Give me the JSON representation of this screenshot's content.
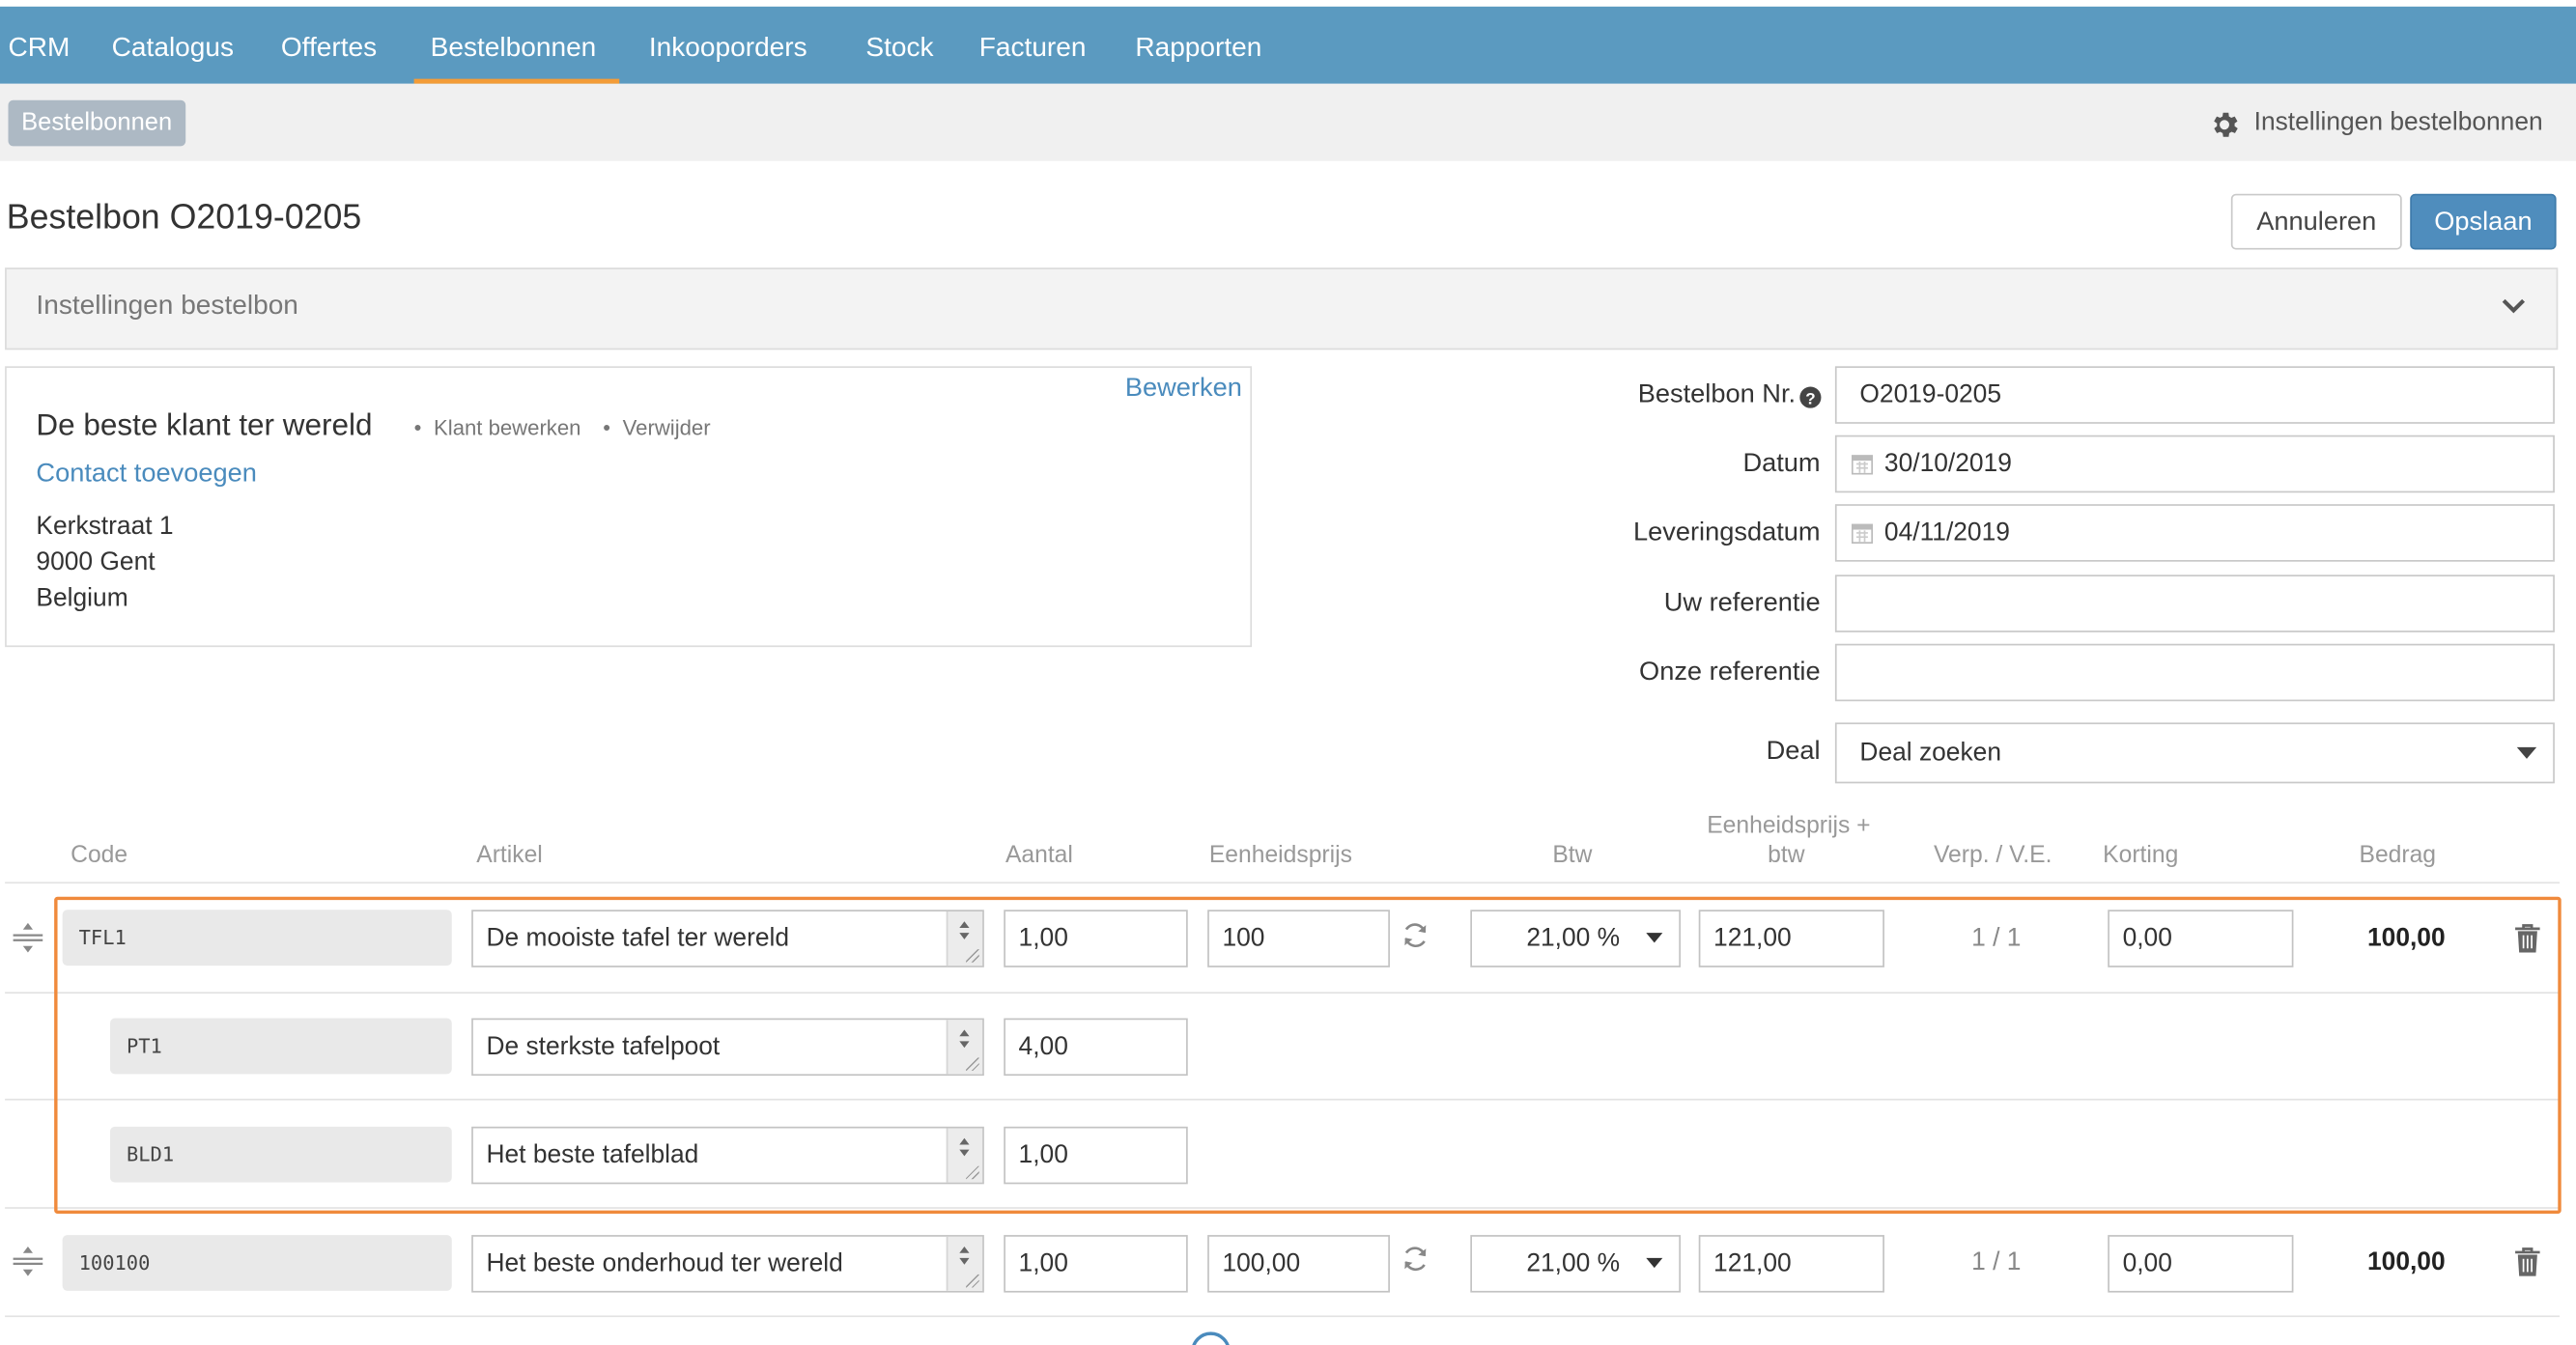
{
  "nav": {
    "items": [
      "CRM",
      "Catalogus",
      "Offertes",
      "Bestelbonnen",
      "Inkooporders",
      "Stock",
      "Facturen",
      "Rapporten"
    ],
    "active": "Bestelbonnen"
  },
  "subbar": {
    "breadcrumb": "Bestelbonnen",
    "settings_link": "Instellingen bestelbonnen"
  },
  "page": {
    "title": "Bestelbon O2019-0205",
    "cancel": "Annuleren",
    "save": "Opslaan"
  },
  "settings_panel": {
    "title": "Instellingen bestelbon"
  },
  "client": {
    "edit": "Bewerken",
    "name": "De beste klant ter wereld",
    "edit_client": "Klant bewerken",
    "remove": "Verwijder",
    "add_contact": "Contact toevoegen",
    "address_line1": "Kerkstraat 1",
    "address_line2": "9000 Gent",
    "country": "Belgium"
  },
  "form": {
    "order_no_label": "Bestelbon Nr.",
    "order_no": "O2019-0205",
    "date_label": "Datum",
    "date": "30/10/2019",
    "delivery_label": "Leveringsdatum",
    "delivery": "04/11/2019",
    "your_ref_label": "Uw referentie",
    "your_ref": "",
    "our_ref_label": "Onze referentie",
    "our_ref": "",
    "deal_label": "Deal",
    "deal_placeholder": "Deal zoeken"
  },
  "table": {
    "headers": {
      "code": "Code",
      "article": "Artikel",
      "qty": "Aantal",
      "unit_price": "Eenheidsprijs",
      "vat": "Btw",
      "unit_price_vat_1": "Eenheidsprijs +",
      "unit_price_vat_2": "btw",
      "pack": "Verp. / V.E.",
      "discount": "Korting",
      "amount": "Bedrag"
    },
    "rows": [
      {
        "code": "TFL1",
        "article": "De mooiste tafel ter wereld",
        "qty": "1,00",
        "unit_price": "100",
        "vat": "21,00 %",
        "price_vat": "121,00",
        "pack": "1 / 1",
        "discount": "0,00",
        "amount": "100,00"
      },
      {
        "code": "PT1",
        "article": "De sterkste tafelpoot",
        "qty": "4,00"
      },
      {
        "code": "BLD1",
        "article": "Het beste tafelblad",
        "qty": "1,00"
      },
      {
        "code": "100100",
        "article": "Het beste onderhoud ter wereld",
        "qty": "1,00",
        "unit_price": "100,00",
        "vat": "21,00 %",
        "price_vat": "121,00",
        "pack": "1 / 1",
        "discount": "0,00",
        "amount": "100,00"
      }
    ]
  },
  "colors": {
    "nav_bg": "#5b9ac0",
    "nav_active": "#f39c38",
    "primary_button": "#4f8dbd",
    "link": "#4a8bbd",
    "highlight_border": "#f08a3c"
  }
}
